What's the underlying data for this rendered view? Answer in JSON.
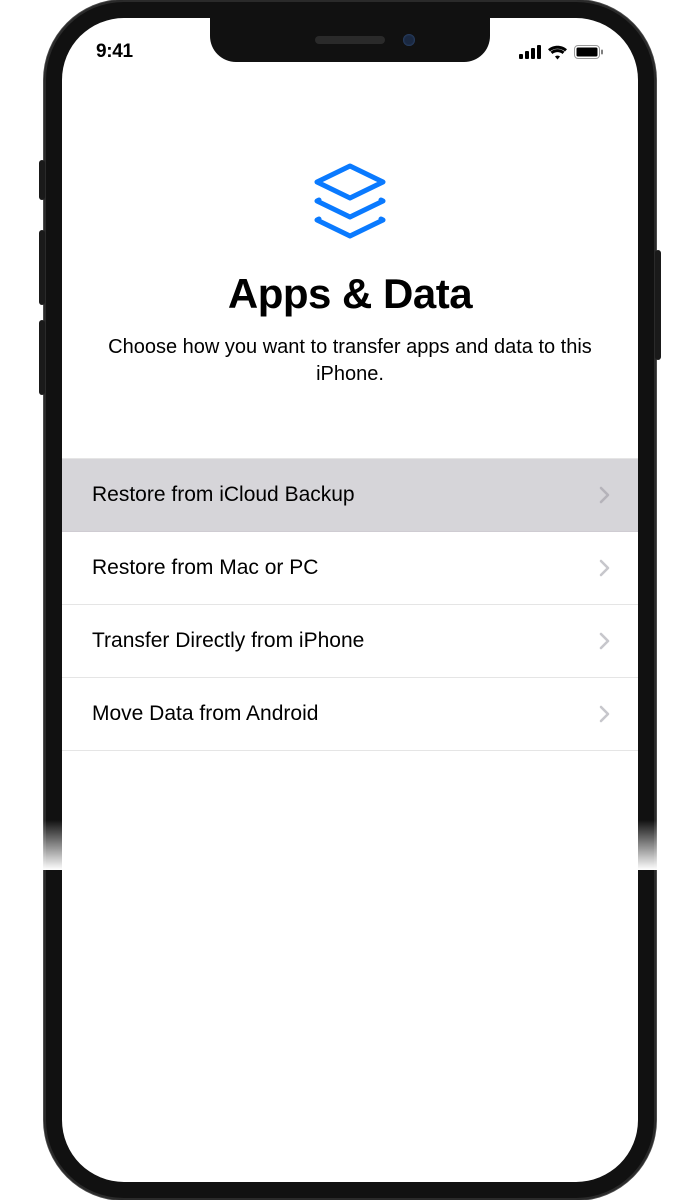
{
  "status_bar": {
    "time": "9:41"
  },
  "header": {
    "title": "Apps & Data",
    "subtitle": "Choose how you want to transfer apps and data to this iPhone."
  },
  "options": [
    {
      "label": "Restore from iCloud Backup",
      "selected": true
    },
    {
      "label": "Restore from Mac or PC",
      "selected": false
    },
    {
      "label": "Transfer Directly from iPhone",
      "selected": false
    },
    {
      "label": "Move Data from Android",
      "selected": false
    }
  ],
  "colors": {
    "accent": "#0a7aff"
  }
}
